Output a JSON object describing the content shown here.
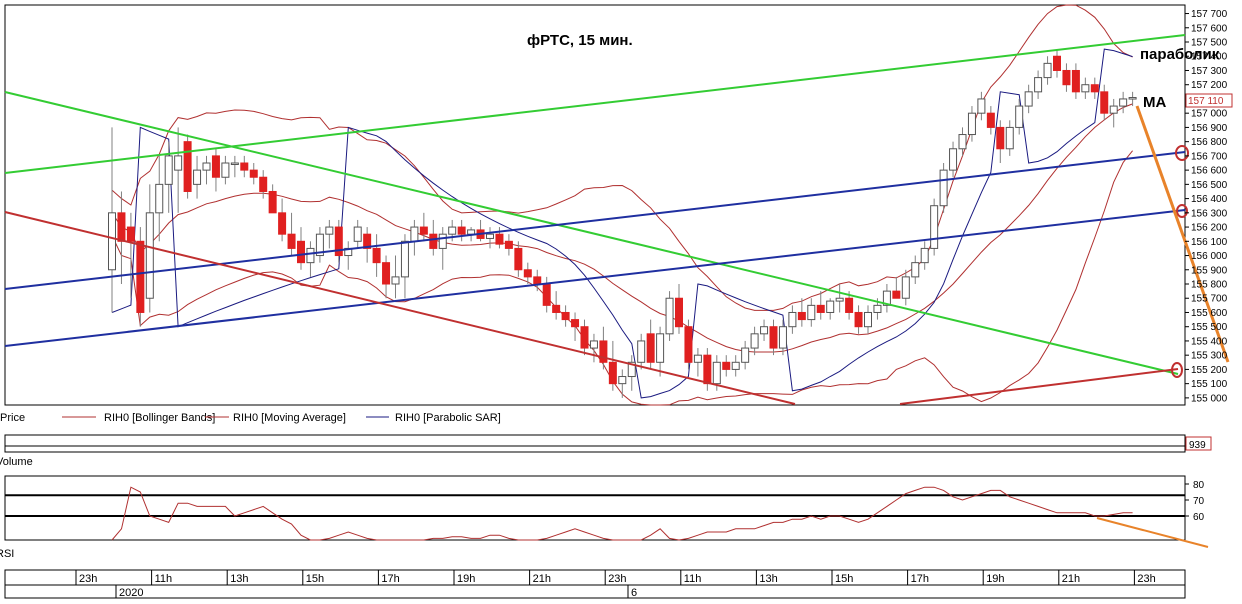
{
  "chart_data": {
    "type": "candlestick",
    "title": "фРТС,  15 мин.",
    "instrument": "RIH0",
    "price_axis": {
      "ylim": [
        154950,
        157760
      ],
      "ticks": [
        "157 700",
        "157 600",
        "157 500",
        "157 400",
        "157 300",
        "157 200",
        "157 110",
        "157 000",
        "156 900",
        "156 800",
        "156 700",
        "156 600",
        "156 500",
        "156 400",
        "156 300",
        "156 200",
        "156 100",
        "156 000",
        "155 900",
        "155 800",
        "155 700",
        "155 600",
        "155 500",
        "155 400",
        "155 300",
        "155 200",
        "155 100",
        "155 000"
      ],
      "last_price_label": "157 110",
      "last_price": 157110
    },
    "time_axis": {
      "ticks": [
        "23h",
        "11h",
        "13h",
        "15h",
        "17h",
        "19h",
        "21h",
        "23h",
        "11h",
        "13h",
        "15h",
        "17h",
        "19h",
        "21h",
        "23h"
      ],
      "dates": [
        "2020",
        "6"
      ]
    },
    "candles": [
      {
        "o": 155900,
        "h": 156900,
        "l": 155600,
        "c": 156300
      },
      {
        "o": 156300,
        "h": 156450,
        "l": 155800,
        "c": 156100
      },
      {
        "o": 156200,
        "h": 156300,
        "l": 155700,
        "c": 156100
      },
      {
        "o": 156100,
        "h": 156200,
        "l": 155500,
        "c": 155600
      },
      {
        "o": 155700,
        "h": 156500,
        "l": 155600,
        "c": 156300
      },
      {
        "o": 156300,
        "h": 156700,
        "l": 156100,
        "c": 156500
      },
      {
        "o": 156500,
        "h": 156800,
        "l": 156300,
        "c": 156700
      },
      {
        "o": 156600,
        "h": 156900,
        "l": 156300,
        "c": 156700
      },
      {
        "o": 156800,
        "h": 156850,
        "l": 156400,
        "c": 156450
      },
      {
        "o": 156500,
        "h": 156700,
        "l": 156400,
        "c": 156600
      },
      {
        "o": 156600,
        "h": 156700,
        "l": 156500,
        "c": 156650
      },
      {
        "o": 156700,
        "h": 156750,
        "l": 156450,
        "c": 156550
      },
      {
        "o": 156550,
        "h": 156700,
        "l": 156500,
        "c": 156650
      },
      {
        "o": 156650,
        "h": 156700,
        "l": 156550,
        "c": 156650
      },
      {
        "o": 156650,
        "h": 156700,
        "l": 156550,
        "c": 156600
      },
      {
        "o": 156600,
        "h": 156650,
        "l": 156500,
        "c": 156550
      },
      {
        "o": 156550,
        "h": 156600,
        "l": 156400,
        "c": 156450
      },
      {
        "o": 156450,
        "h": 156500,
        "l": 156300,
        "c": 156300
      },
      {
        "o": 156300,
        "h": 156400,
        "l": 156100,
        "c": 156150
      },
      {
        "o": 156150,
        "h": 156300,
        "l": 156000,
        "c": 156050
      },
      {
        "o": 156100,
        "h": 156200,
        "l": 155900,
        "c": 155950
      },
      {
        "o": 155950,
        "h": 156100,
        "l": 155850,
        "c": 156050
      },
      {
        "o": 156000,
        "h": 156200,
        "l": 155950,
        "c": 156150
      },
      {
        "o": 156150,
        "h": 156250,
        "l": 156050,
        "c": 156200
      },
      {
        "o": 156200,
        "h": 156250,
        "l": 155950,
        "c": 156000
      },
      {
        "o": 156000,
        "h": 156100,
        "l": 155900,
        "c": 156050
      },
      {
        "o": 156100,
        "h": 156250,
        "l": 156050,
        "c": 156200
      },
      {
        "o": 156150,
        "h": 156200,
        "l": 155950,
        "c": 156050
      },
      {
        "o": 156050,
        "h": 156150,
        "l": 155850,
        "c": 155950
      },
      {
        "o": 155950,
        "h": 156000,
        "l": 155700,
        "c": 155800
      },
      {
        "o": 155800,
        "h": 156000,
        "l": 155700,
        "c": 155850
      },
      {
        "o": 155850,
        "h": 156150,
        "l": 155700,
        "c": 156100
      },
      {
        "o": 156100,
        "h": 156250,
        "l": 156000,
        "c": 156200
      },
      {
        "o": 156200,
        "h": 156300,
        "l": 156100,
        "c": 156150
      },
      {
        "o": 156150,
        "h": 156250,
        "l": 156000,
        "c": 156050
      },
      {
        "o": 156050,
        "h": 156200,
        "l": 155900,
        "c": 156150
      },
      {
        "o": 156150,
        "h": 156250,
        "l": 156100,
        "c": 156200
      },
      {
        "o": 156200,
        "h": 156250,
        "l": 156100,
        "c": 156150
      },
      {
        "o": 156150,
        "h": 156200,
        "l": 156100,
        "c": 156180
      },
      {
        "o": 156180,
        "h": 156250,
        "l": 156100,
        "c": 156120
      },
      {
        "o": 156120,
        "h": 156200,
        "l": 156050,
        "c": 156150
      },
      {
        "o": 156150,
        "h": 156200,
        "l": 156050,
        "c": 156080
      },
      {
        "o": 156100,
        "h": 156150,
        "l": 156000,
        "c": 156050
      },
      {
        "o": 156050,
        "h": 156100,
        "l": 155850,
        "c": 155900
      },
      {
        "o": 155900,
        "h": 155950,
        "l": 155800,
        "c": 155850
      },
      {
        "o": 155850,
        "h": 155900,
        "l": 155750,
        "c": 155800
      },
      {
        "o": 155800,
        "h": 155850,
        "l": 155600,
        "c": 155650
      },
      {
        "o": 155650,
        "h": 155750,
        "l": 155550,
        "c": 155600
      },
      {
        "o": 155600,
        "h": 155650,
        "l": 155500,
        "c": 155550
      },
      {
        "o": 155550,
        "h": 155600,
        "l": 155400,
        "c": 155500
      },
      {
        "o": 155500,
        "h": 155550,
        "l": 155300,
        "c": 155350
      },
      {
        "o": 155350,
        "h": 155450,
        "l": 155250,
        "c": 155400
      },
      {
        "o": 155400,
        "h": 155500,
        "l": 155200,
        "c": 155250
      },
      {
        "o": 155250,
        "h": 155400,
        "l": 155050,
        "c": 155100
      },
      {
        "o": 155100,
        "h": 155200,
        "l": 155000,
        "c": 155150
      },
      {
        "o": 155150,
        "h": 155300,
        "l": 155050,
        "c": 155250
      },
      {
        "o": 155250,
        "h": 155450,
        "l": 155200,
        "c": 155400
      },
      {
        "o": 155450,
        "h": 155550,
        "l": 155200,
        "c": 155250
      },
      {
        "o": 155250,
        "h": 155500,
        "l": 155150,
        "c": 155450
      },
      {
        "o": 155450,
        "h": 155750,
        "l": 155400,
        "c": 155700
      },
      {
        "o": 155700,
        "h": 155800,
        "l": 155450,
        "c": 155500
      },
      {
        "o": 155500,
        "h": 155550,
        "l": 155200,
        "c": 155250
      },
      {
        "o": 155250,
        "h": 155350,
        "l": 155150,
        "c": 155300
      },
      {
        "o": 155300,
        "h": 155350,
        "l": 155050,
        "c": 155100
      },
      {
        "o": 155100,
        "h": 155300,
        "l": 155050,
        "c": 155250
      },
      {
        "o": 155250,
        "h": 155300,
        "l": 155150,
        "c": 155200
      },
      {
        "o": 155200,
        "h": 155300,
        "l": 155150,
        "c": 155250
      },
      {
        "o": 155250,
        "h": 155400,
        "l": 155200,
        "c": 155350
      },
      {
        "o": 155350,
        "h": 155500,
        "l": 155300,
        "c": 155450
      },
      {
        "o": 155450,
        "h": 155550,
        "l": 155400,
        "c": 155500
      },
      {
        "o": 155500,
        "h": 155550,
        "l": 155300,
        "c": 155350
      },
      {
        "o": 155350,
        "h": 155550,
        "l": 155300,
        "c": 155500
      },
      {
        "o": 155500,
        "h": 155650,
        "l": 155450,
        "c": 155600
      },
      {
        "o": 155600,
        "h": 155700,
        "l": 155500,
        "c": 155550
      },
      {
        "o": 155550,
        "h": 155700,
        "l": 155500,
        "c": 155650
      },
      {
        "o": 155650,
        "h": 155750,
        "l": 155550,
        "c": 155600
      },
      {
        "o": 155600,
        "h": 155700,
        "l": 155550,
        "c": 155680
      },
      {
        "o": 155680,
        "h": 155800,
        "l": 155600,
        "c": 155700
      },
      {
        "o": 155700,
        "h": 155750,
        "l": 155550,
        "c": 155600
      },
      {
        "o": 155600,
        "h": 155650,
        "l": 155450,
        "c": 155500
      },
      {
        "o": 155500,
        "h": 155650,
        "l": 155450,
        "c": 155600
      },
      {
        "o": 155600,
        "h": 155700,
        "l": 155550,
        "c": 155650
      },
      {
        "o": 155650,
        "h": 155800,
        "l": 155600,
        "c": 155750
      },
      {
        "o": 155750,
        "h": 155850,
        "l": 155700,
        "c": 155700
      },
      {
        "o": 155700,
        "h": 155900,
        "l": 155650,
        "c": 155850
      },
      {
        "o": 155850,
        "h": 156000,
        "l": 155800,
        "c": 155950
      },
      {
        "o": 155950,
        "h": 156100,
        "l": 155900,
        "c": 156050
      },
      {
        "o": 156050,
        "h": 156400,
        "l": 156000,
        "c": 156350
      },
      {
        "o": 156350,
        "h": 156650,
        "l": 156300,
        "c": 156600
      },
      {
        "o": 156600,
        "h": 156800,
        "l": 156550,
        "c": 156750
      },
      {
        "o": 156750,
        "h": 156900,
        "l": 156700,
        "c": 156850
      },
      {
        "o": 156850,
        "h": 157050,
        "l": 156800,
        "c": 157000
      },
      {
        "o": 157000,
        "h": 157150,
        "l": 156950,
        "c": 157100
      },
      {
        "o": 157000,
        "h": 157050,
        "l": 156850,
        "c": 156900
      },
      {
        "o": 156900,
        "h": 156950,
        "l": 156650,
        "c": 156750
      },
      {
        "o": 156750,
        "h": 156950,
        "l": 156700,
        "c": 156900
      },
      {
        "o": 156900,
        "h": 157100,
        "l": 156850,
        "c": 157050
      },
      {
        "o": 157050,
        "h": 157200,
        "l": 157000,
        "c": 157150
      },
      {
        "o": 157150,
        "h": 157300,
        "l": 157100,
        "c": 157250
      },
      {
        "o": 157250,
        "h": 157400,
        "l": 157200,
        "c": 157350
      },
      {
        "o": 157400,
        "h": 157450,
        "l": 157250,
        "c": 157300
      },
      {
        "o": 157300,
        "h": 157350,
        "l": 157150,
        "c": 157200
      },
      {
        "o": 157300,
        "h": 157350,
        "l": 157100,
        "c": 157150
      },
      {
        "o": 157150,
        "h": 157250,
        "l": 157100,
        "c": 157200
      },
      {
        "o": 157200,
        "h": 157250,
        "l": 157100,
        "c": 157150
      },
      {
        "o": 157150,
        "h": 157200,
        "l": 156950,
        "c": 157000
      },
      {
        "o": 157000,
        "h": 157100,
        "l": 156900,
        "c": 157050
      },
      {
        "o": 157050,
        "h": 157150,
        "l": 157000,
        "c": 157100
      },
      {
        "o": 157100,
        "h": 157150,
        "l": 157050,
        "c": 157110
      }
    ],
    "legend": [
      {
        "name": "Price",
        "color": "#000000"
      },
      {
        "name": "RIH0 [Bollinger Bands]",
        "color": "#b03030"
      },
      {
        "name": "RIH0 [Moving Average]",
        "color": "#b03030"
      },
      {
        "name": "RIH0 [Parabolic SAR]",
        "color": "#1a1a80"
      }
    ],
    "annotations": [
      "параболик",
      "MA"
    ],
    "volume_panel": {
      "label": "Volume",
      "value_label": "939"
    },
    "rsi_panel": {
      "label": "RSI",
      "ticks": [
        "80",
        "70",
        "60"
      ],
      "levels": [
        73,
        60
      ],
      "values": [
        40,
        52,
        78,
        75,
        60,
        58,
        56,
        68,
        68,
        66,
        66,
        66,
        66,
        60,
        62,
        64,
        66,
        62,
        58,
        55,
        48,
        44,
        42,
        46,
        48,
        50,
        48,
        46,
        44,
        42,
        40,
        40,
        42,
        44,
        46,
        46,
        47,
        47,
        46,
        46,
        48,
        48,
        46,
        42,
        42,
        42,
        46,
        48,
        50,
        52,
        50,
        48,
        46,
        40,
        40,
        42,
        44,
        48,
        52,
        46,
        44,
        46,
        48,
        50,
        50,
        50,
        52,
        52,
        52,
        54,
        56,
        56,
        58,
        58,
        60,
        58,
        60,
        60,
        58,
        56,
        58,
        62,
        66,
        70,
        74,
        76,
        78,
        78,
        76,
        72,
        70,
        72,
        74,
        76,
        76,
        72,
        70,
        68,
        66,
        64,
        62,
        62,
        62,
        62,
        60,
        60,
        61,
        62,
        62
      ]
    }
  },
  "colors": {
    "candle_up": "#ffffff",
    "candle_down": "#e02020",
    "wick": "#808080",
    "green_channel": "#33cc33",
    "blue_channel": "#1f2fa0",
    "red_channel": "#c03030",
    "orange_arrow": "#e8832a",
    "bb": "#b03030",
    "sar": "#1a1a80"
  }
}
